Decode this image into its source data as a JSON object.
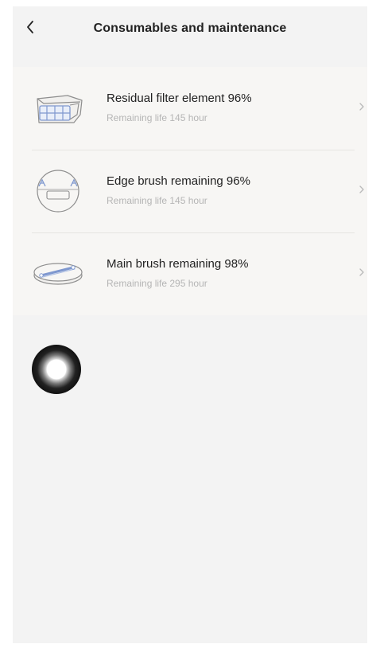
{
  "header": {
    "back_icon": "chevron-left-icon",
    "title": "Consumables and maintenance"
  },
  "consumables": [
    {
      "icon": "filter-icon",
      "title": "Residual filter element 96%",
      "subtitle": "Remaining life 145 hour",
      "percent": 96
    },
    {
      "icon": "edge-brush-icon",
      "title": "Edge brush remaining 96%",
      "subtitle": "Remaining life 145 hour",
      "percent": 96
    },
    {
      "icon": "main-brush-icon",
      "title": "Main brush remaining 98%",
      "subtitle": "Remaining life 295 hour",
      "percent": 98
    }
  ],
  "colors": {
    "page_background": "#f3f3f3",
    "list_background": "#f7f6f4",
    "title_text": "#222222",
    "subtitle_text": "#b5b5b5",
    "icon_accent": "#8fa7d9"
  }
}
